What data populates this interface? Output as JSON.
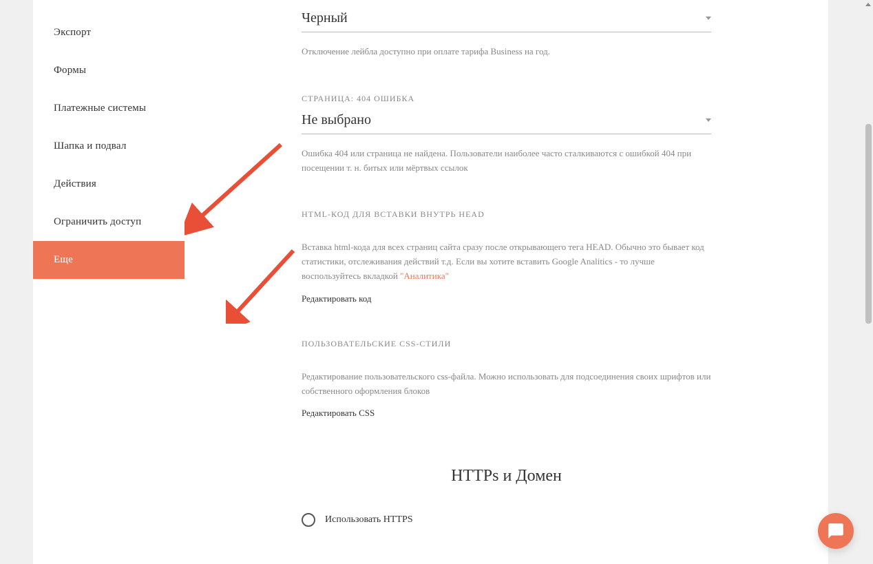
{
  "sidebar": {
    "items": [
      {
        "label": "Экспорт"
      },
      {
        "label": "Формы"
      },
      {
        "label": "Платежные системы"
      },
      {
        "label": "Шапка и подвал"
      },
      {
        "label": "Действия"
      },
      {
        "label": "Ограничить доступ"
      },
      {
        "label": "Еще"
      }
    ]
  },
  "color_block": {
    "value": "Черный",
    "help": "Отключение лейбла доступно при оплате тарифа Business на год."
  },
  "page404_block": {
    "label": "СТРАНИЦА: 404 ОШИБКА",
    "value": "Не выбрано",
    "help": "Ошибка 404 или страница не найдена. Пользователи наиболее часто сталкиваются с ошибкой 404 при посещении т. н. битых или мёртвых ссылок"
  },
  "head_block": {
    "label": "HTML-КОД ДЛЯ ВСТАВКИ ВНУТРЬ HEAD",
    "help_pre": "Вставка html-кода для всех страниц сайта сразу после открывающего тега HEAD. Обычно это бывает код статистики, отслеживания действий т.д. Если вы хотите вставить Google Analitics - то лучше воспользуйтесь вкладкой ",
    "link": "\"Аналитика\"",
    "edit": "Редактировать код"
  },
  "css_block": {
    "label": "ПОЛЬЗОВАТЕЛЬСКИЕ CSS-СТИЛИ",
    "help": "Редактирование пользовательского css-файла. Можно использовать для подсоединения своих шрифтов или собственного оформления блоков",
    "edit": "Редактировать CSS"
  },
  "https_block": {
    "title": "HTTPs и Домен",
    "radio": "Использовать HTTPS"
  }
}
